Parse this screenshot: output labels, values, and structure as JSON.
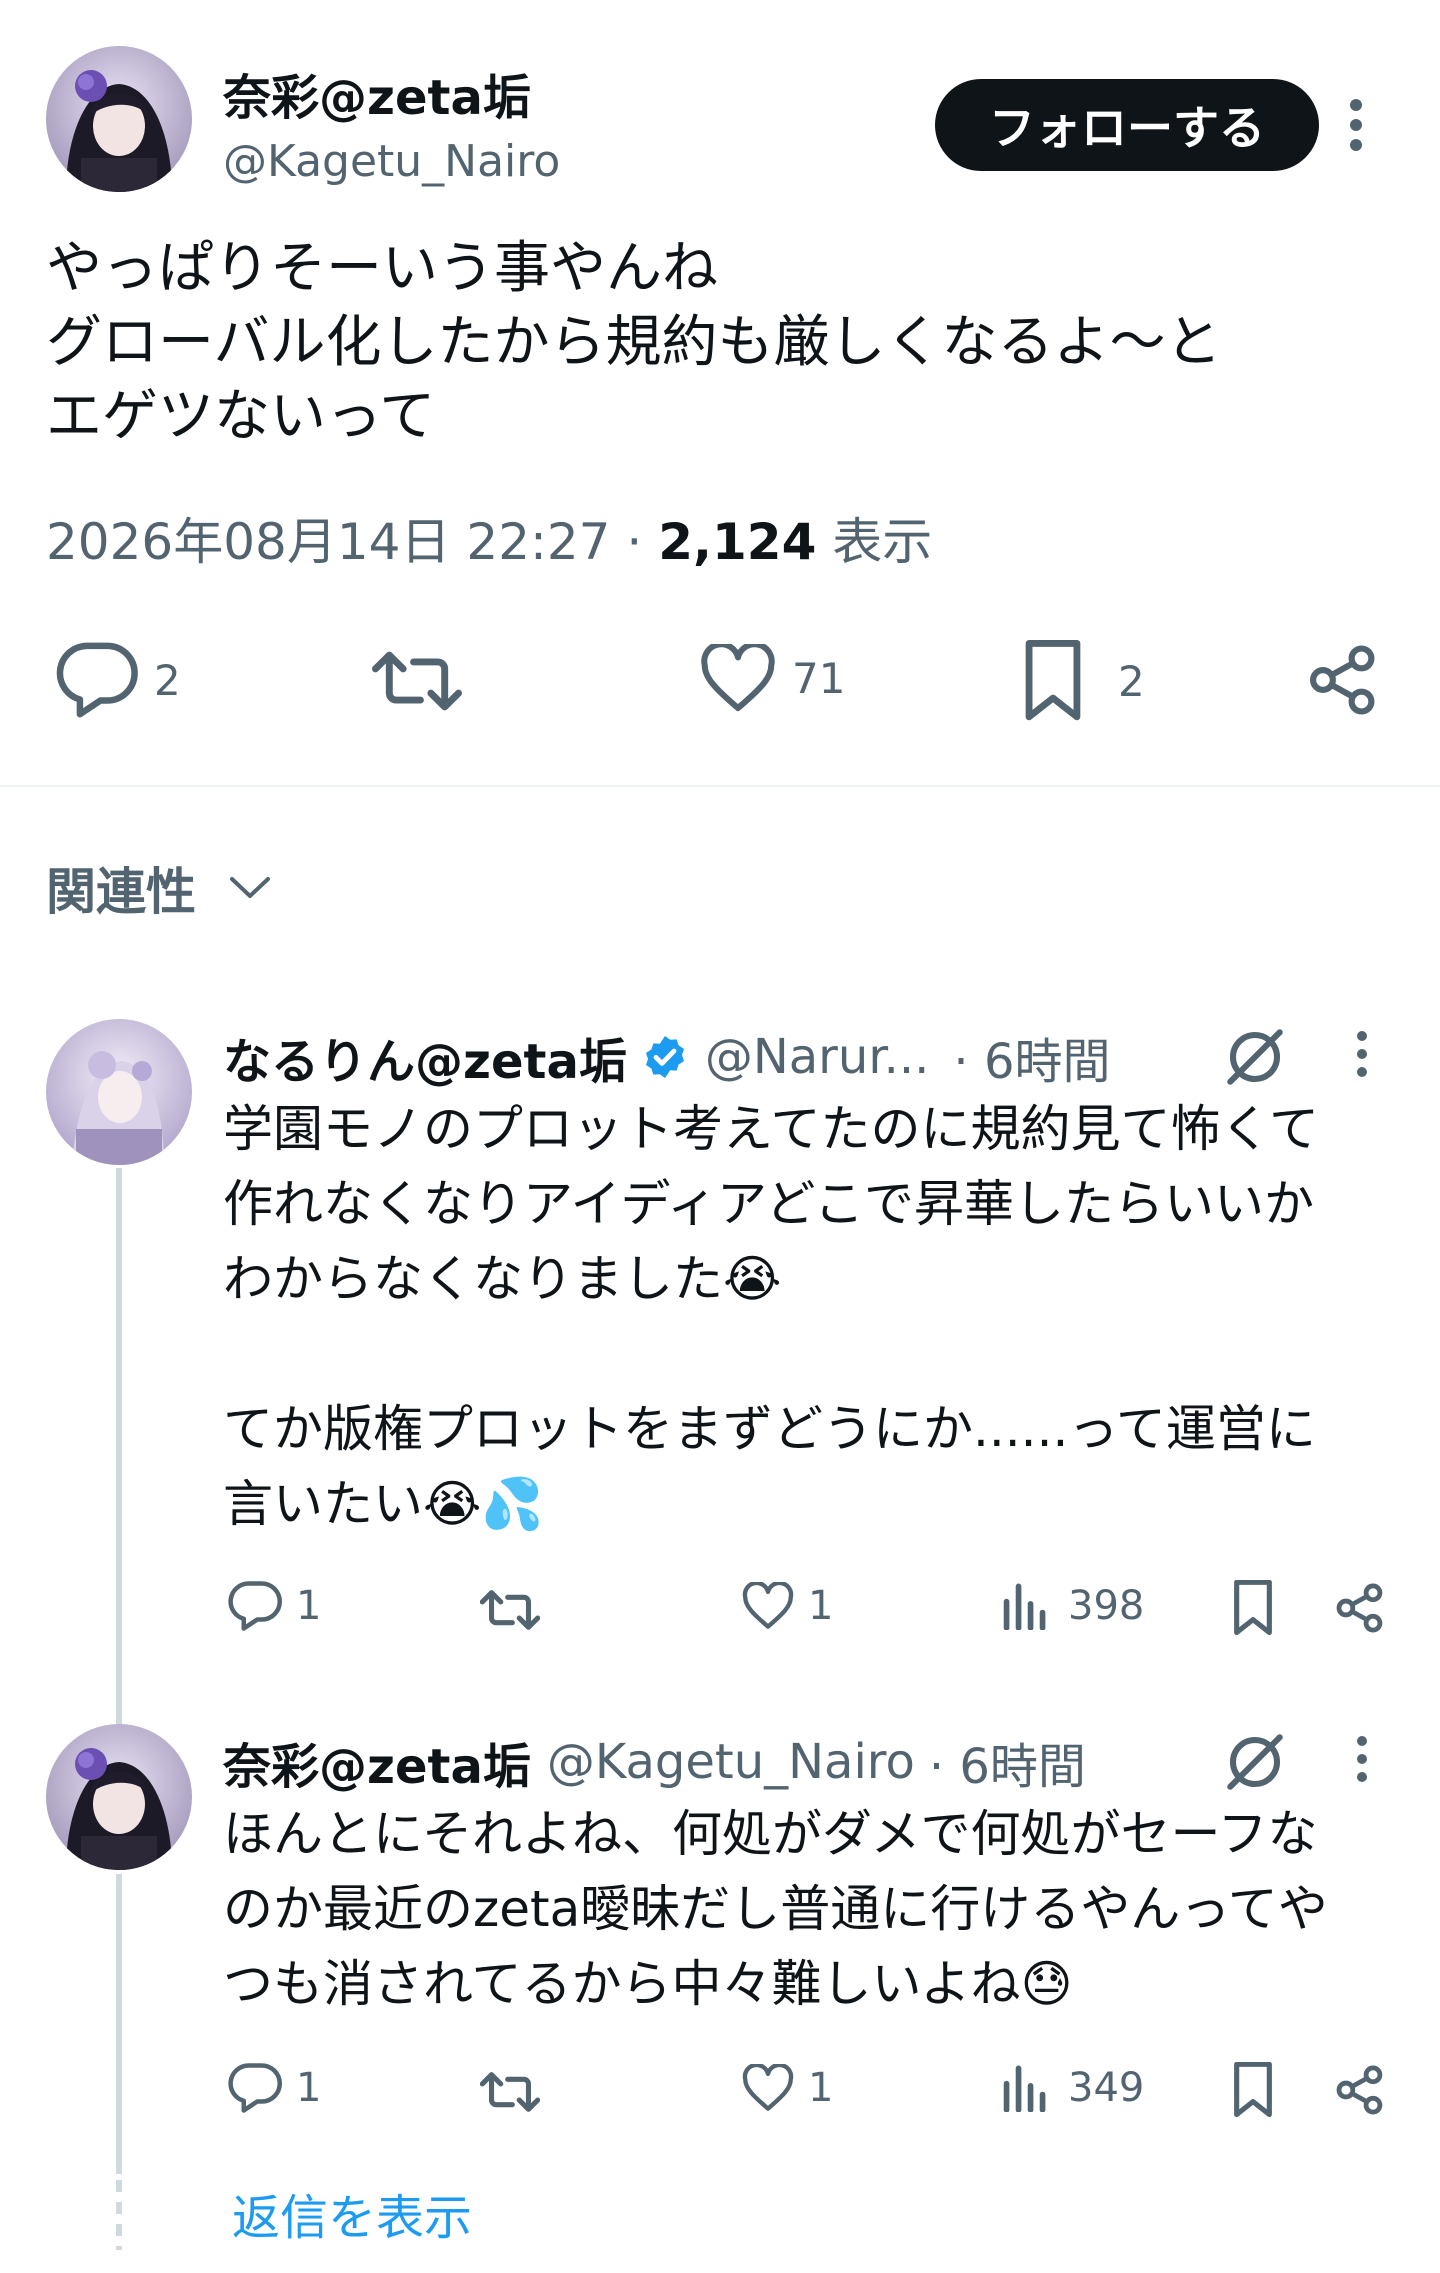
{
  "main_tweet": {
    "display_name": "奈彩@zeta垢",
    "handle": "@Kagetu_Nairo",
    "follow_label": "フォローする",
    "text": "やっぱりそーいう事やんね\nグローバル化したから規約も厳しくなるよ～と\nエゲツないって",
    "date": "2026年08月14日 22:27",
    "separator": "·",
    "views_count": "2,124",
    "views_label": "表示",
    "actions": {
      "replies": "2",
      "likes": "71",
      "bookmarks": "2"
    },
    "icons": [
      "reply-icon",
      "retweet-icon",
      "like-icon",
      "bookmark-icon",
      "share-icon",
      "more-icon"
    ]
  },
  "relevance_label": "関連性",
  "replies": [
    {
      "display_name": "なるりん@zeta垢",
      "verified": true,
      "handle": "@Narur...",
      "time": "· 6時間",
      "text": "学園モノのプロット考えてたのに規約見て怖くて\n作れなくなりアイディアどこで昇華したらいいか\nわからなくなりました😭\n\nてか版権プロットをまずどうにか......って運営に\n言いたい😭💦",
      "actions": {
        "replies": "1",
        "likes": "1",
        "views": "398"
      }
    },
    {
      "display_name": "奈彩@zeta垢",
      "verified": false,
      "handle": "@Kagetu_Nairo",
      "time": "· 6時間",
      "text": "ほんとにそれよね、何処がダメで何処がセーフな\nのか最近のzeta曖昧だし普通に行けるやんってや\nつも消されてるから中々難しいよね😓",
      "actions": {
        "replies": "1",
        "likes": "1",
        "views": "349"
      }
    }
  ],
  "show_replies_label": "返信を表示",
  "colors": {
    "text": "#0f1419",
    "secondary": "#536471",
    "link": "#1d9bf0",
    "verified": "#1d9bf0",
    "button_bg": "#0f1419",
    "divider": "#eff3f4"
  }
}
